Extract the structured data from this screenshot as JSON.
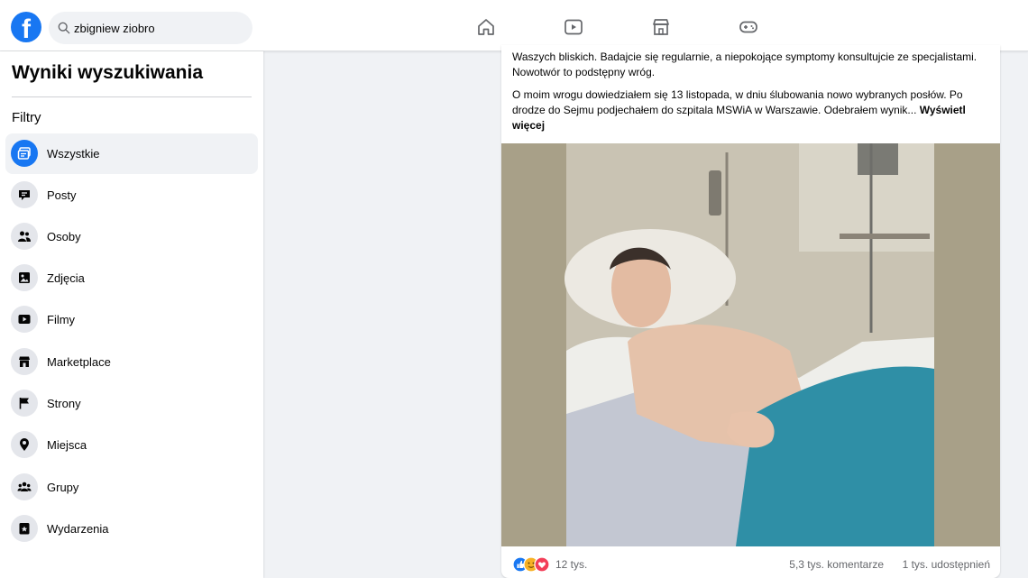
{
  "topbar": {
    "logo_letter": "f",
    "search_value": "zbigniew ziobro",
    "nav_icons": [
      "home-icon",
      "video-icon",
      "marketplace-icon",
      "gaming-icon"
    ]
  },
  "sidebar": {
    "title": "Wyniki wyszukiwania",
    "filters_label": "Filtry",
    "items": [
      {
        "label": "Wszystkie",
        "icon": "all-results-icon",
        "active": true
      },
      {
        "label": "Posty",
        "icon": "posts-icon"
      },
      {
        "label": "Osoby",
        "icon": "people-icon"
      },
      {
        "label": "Zdjęcia",
        "icon": "photos-icon"
      },
      {
        "label": "Filmy",
        "icon": "videos-icon"
      },
      {
        "label": "Marketplace",
        "icon": "marketplace-icon"
      },
      {
        "label": "Strony",
        "icon": "pages-flag-icon"
      },
      {
        "label": "Miejsca",
        "icon": "places-pin-icon"
      },
      {
        "label": "Grupy",
        "icon": "groups-icon"
      },
      {
        "label": "Wydarzenia",
        "icon": "events-icon"
      }
    ]
  },
  "post": {
    "paragraph1": "Waszych bliskich. Badajcie się regularnie, a niepokojące symptomy konsultujcie ze specjalistami. Nowotwór to podstępny wróg.",
    "paragraph2": "O moim wrogu dowiedziałem się 13 listopada, w dniu ślubowania nowo wybranych posłów. Po drodze do Sejmu podjechałem do szpitala MSWiA w Warszawie. Odebrałem wynik...",
    "see_more": "Wyświetl więcej",
    "reactions_count": "12 tys.",
    "comments": "5,3 tys. komentarze",
    "shares": "1 tys. udostępnień"
  },
  "colors": {
    "brand": "#1877f2",
    "background": "#f0f2f5",
    "secondary_text": "#65676b"
  }
}
